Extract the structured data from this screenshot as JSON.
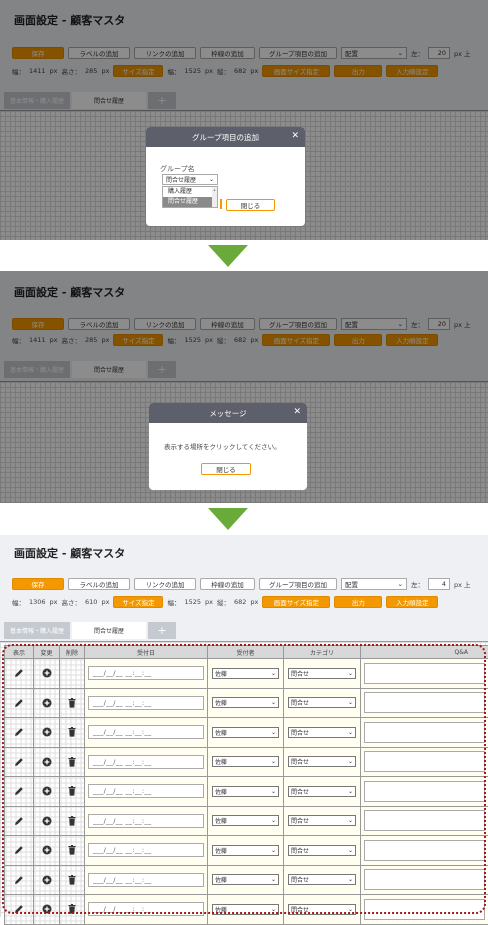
{
  "page_title": "画面設定 - 顧客マスタ",
  "toolbar": {
    "save": "保存",
    "add_label": "ラベルの追加",
    "add_link": "リンクの追加",
    "add_frame": "枠線の追加",
    "add_group": "グループ項目の追加",
    "arrange": "配置",
    "left_label": "左：",
    "px_top": "px 上",
    "width_label": "幅：",
    "height_label": "高さ：",
    "px": "px",
    "size_set": "サイズ指定",
    "vert_label": "縦：",
    "screen_size": "画面サイズ指定",
    "output": "出力",
    "input_order": "入力順設定"
  },
  "panels": [
    {
      "left_value": "20",
      "width_value": "1411",
      "height_value": "285",
      "screen_width": "1525",
      "screen_height": "682"
    },
    {
      "left_value": "20",
      "width_value": "1411",
      "height_value": "285",
      "screen_width": "1525",
      "screen_height": "682"
    },
    {
      "left_value": "4",
      "width_value": "1306",
      "height_value": "610",
      "screen_width": "1525",
      "screen_height": "682"
    }
  ],
  "tabs": {
    "tab1": "基本情報・購入履歴",
    "tab2": "問合せ履歴",
    "plus": "+"
  },
  "dialog_group": {
    "title": "グループ項目の追加",
    "group_label": "グループ名",
    "selected": "問合せ履歴",
    "options": [
      "購入履歴",
      "問合せ履歴"
    ],
    "close": "閉じる"
  },
  "dialog_message": {
    "title": "メッセージ",
    "body": "表示する場所をクリックしてください。",
    "close": "閉じる"
  },
  "table": {
    "headers": [
      "表示",
      "変更",
      "削除",
      "受付日",
      "受付者",
      "カテゴリ",
      "Q&A"
    ],
    "date_placeholder": "___/__/__ __:__:__",
    "receiver": "佐藤",
    "category": "問合せ"
  },
  "colors": {
    "accent": "#f39800",
    "dialog_header": "#5d606b",
    "arrow": "#6aaa3a",
    "highlight": "#a0191e"
  }
}
